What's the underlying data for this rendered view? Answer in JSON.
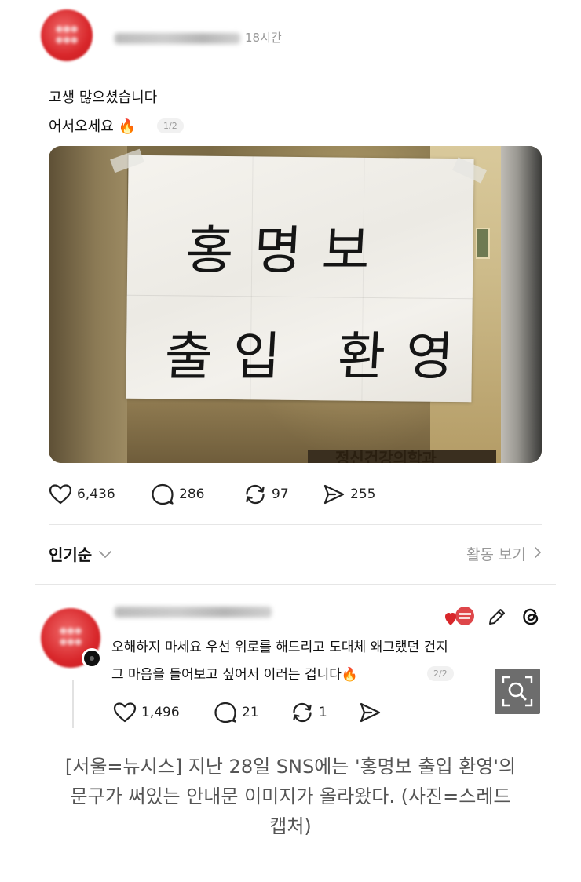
{
  "post": {
    "time": "18시간",
    "text_line1": "고생 많으셨습니다",
    "text_line2": "어서오세요 🔥",
    "page_indicator": "1/2",
    "photo": {
      "sign_line1": "홍명보",
      "sign_line2": "출입 환영",
      "dept_sign": "정신건강의학과"
    },
    "stats": {
      "likes": "6,436",
      "comments": "286",
      "reposts": "97",
      "shares": "255"
    }
  },
  "sort_bar": {
    "sort_label": "인기순",
    "activity_label": "활동 보기"
  },
  "reply": {
    "text_line1": "오해하지 마세요 우선 위로를 해드리고 도대체 왜그랬던 건지",
    "text_line2": "그 마음을 들어보고 싶어서 이러는 겁니다🔥",
    "page_indicator": "2/2",
    "stats": {
      "likes": "1,496",
      "comments": "21",
      "reposts": "1"
    }
  },
  "caption": {
    "line1": "[서울=뉴시스] 지난 28일 SNS에는 '홍명보 출입 환영'의",
    "line2": "문구가 써있는 안내문 이미지가 올라왔다. (사진=스레드",
    "line3": "캡처)"
  },
  "icons": {
    "like": "heart-icon",
    "comment": "comment-icon",
    "repost": "repost-icon",
    "share": "send-icon",
    "sort_toggle": "chevron-down-icon",
    "activity": "chevron-right-icon",
    "edit": "pencil-icon",
    "threads": "threads-logo-icon",
    "zoom": "zoom-icon"
  },
  "colors": {
    "avatar_red": "#d8262a",
    "muted_text": "#999999",
    "zoom_bg": "#6d6d6d"
  }
}
